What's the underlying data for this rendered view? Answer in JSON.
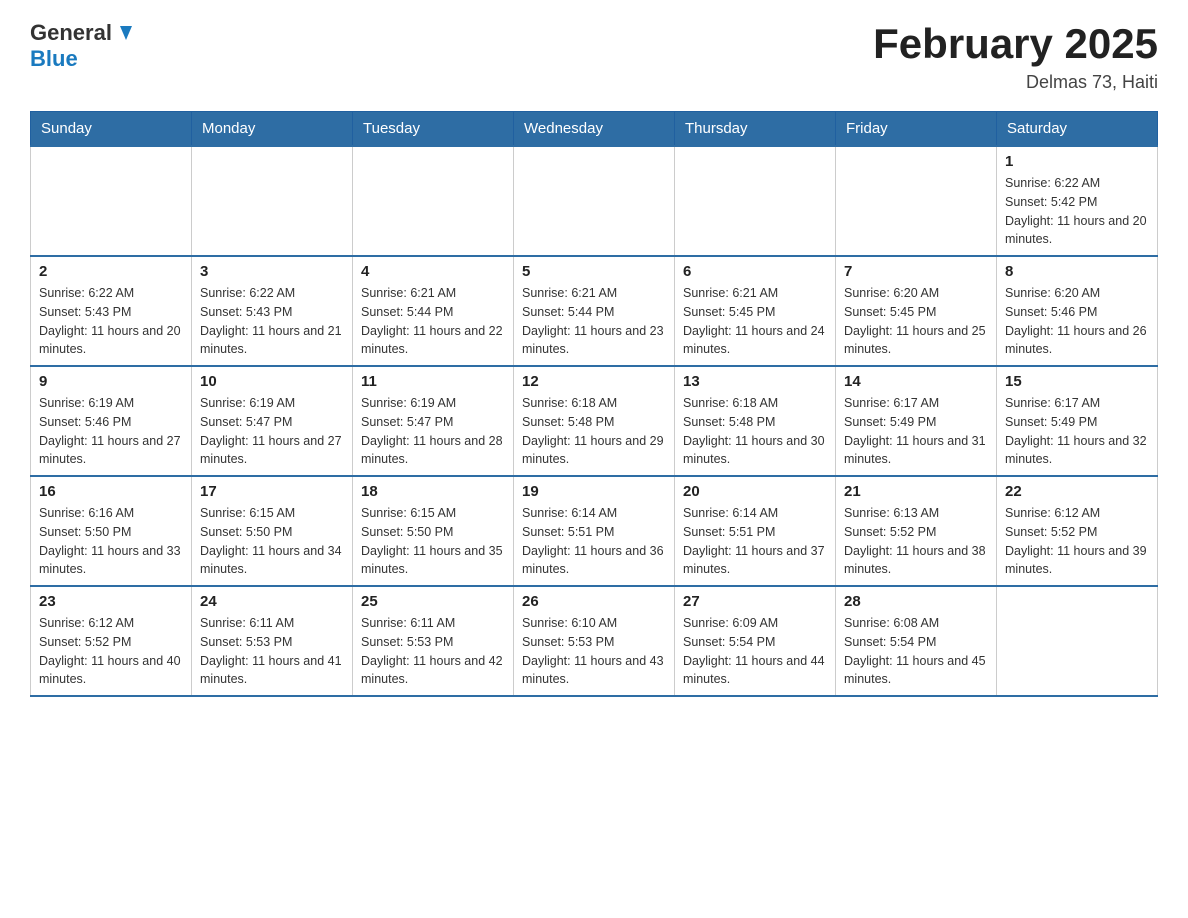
{
  "header": {
    "logo_general": "General",
    "logo_blue": "Blue",
    "month_title": "February 2025",
    "location": "Delmas 73, Haiti"
  },
  "days_of_week": [
    "Sunday",
    "Monday",
    "Tuesday",
    "Wednesday",
    "Thursday",
    "Friday",
    "Saturday"
  ],
  "weeks": [
    [
      {
        "day": "",
        "info": ""
      },
      {
        "day": "",
        "info": ""
      },
      {
        "day": "",
        "info": ""
      },
      {
        "day": "",
        "info": ""
      },
      {
        "day": "",
        "info": ""
      },
      {
        "day": "",
        "info": ""
      },
      {
        "day": "1",
        "info": "Sunrise: 6:22 AM\nSunset: 5:42 PM\nDaylight: 11 hours and 20 minutes."
      }
    ],
    [
      {
        "day": "2",
        "info": "Sunrise: 6:22 AM\nSunset: 5:43 PM\nDaylight: 11 hours and 20 minutes."
      },
      {
        "day": "3",
        "info": "Sunrise: 6:22 AM\nSunset: 5:43 PM\nDaylight: 11 hours and 21 minutes."
      },
      {
        "day": "4",
        "info": "Sunrise: 6:21 AM\nSunset: 5:44 PM\nDaylight: 11 hours and 22 minutes."
      },
      {
        "day": "5",
        "info": "Sunrise: 6:21 AM\nSunset: 5:44 PM\nDaylight: 11 hours and 23 minutes."
      },
      {
        "day": "6",
        "info": "Sunrise: 6:21 AM\nSunset: 5:45 PM\nDaylight: 11 hours and 24 minutes."
      },
      {
        "day": "7",
        "info": "Sunrise: 6:20 AM\nSunset: 5:45 PM\nDaylight: 11 hours and 25 minutes."
      },
      {
        "day": "8",
        "info": "Sunrise: 6:20 AM\nSunset: 5:46 PM\nDaylight: 11 hours and 26 minutes."
      }
    ],
    [
      {
        "day": "9",
        "info": "Sunrise: 6:19 AM\nSunset: 5:46 PM\nDaylight: 11 hours and 27 minutes."
      },
      {
        "day": "10",
        "info": "Sunrise: 6:19 AM\nSunset: 5:47 PM\nDaylight: 11 hours and 27 minutes."
      },
      {
        "day": "11",
        "info": "Sunrise: 6:19 AM\nSunset: 5:47 PM\nDaylight: 11 hours and 28 minutes."
      },
      {
        "day": "12",
        "info": "Sunrise: 6:18 AM\nSunset: 5:48 PM\nDaylight: 11 hours and 29 minutes."
      },
      {
        "day": "13",
        "info": "Sunrise: 6:18 AM\nSunset: 5:48 PM\nDaylight: 11 hours and 30 minutes."
      },
      {
        "day": "14",
        "info": "Sunrise: 6:17 AM\nSunset: 5:49 PM\nDaylight: 11 hours and 31 minutes."
      },
      {
        "day": "15",
        "info": "Sunrise: 6:17 AM\nSunset: 5:49 PM\nDaylight: 11 hours and 32 minutes."
      }
    ],
    [
      {
        "day": "16",
        "info": "Sunrise: 6:16 AM\nSunset: 5:50 PM\nDaylight: 11 hours and 33 minutes."
      },
      {
        "day": "17",
        "info": "Sunrise: 6:15 AM\nSunset: 5:50 PM\nDaylight: 11 hours and 34 minutes."
      },
      {
        "day": "18",
        "info": "Sunrise: 6:15 AM\nSunset: 5:50 PM\nDaylight: 11 hours and 35 minutes."
      },
      {
        "day": "19",
        "info": "Sunrise: 6:14 AM\nSunset: 5:51 PM\nDaylight: 11 hours and 36 minutes."
      },
      {
        "day": "20",
        "info": "Sunrise: 6:14 AM\nSunset: 5:51 PM\nDaylight: 11 hours and 37 minutes."
      },
      {
        "day": "21",
        "info": "Sunrise: 6:13 AM\nSunset: 5:52 PM\nDaylight: 11 hours and 38 minutes."
      },
      {
        "day": "22",
        "info": "Sunrise: 6:12 AM\nSunset: 5:52 PM\nDaylight: 11 hours and 39 minutes."
      }
    ],
    [
      {
        "day": "23",
        "info": "Sunrise: 6:12 AM\nSunset: 5:52 PM\nDaylight: 11 hours and 40 minutes."
      },
      {
        "day": "24",
        "info": "Sunrise: 6:11 AM\nSunset: 5:53 PM\nDaylight: 11 hours and 41 minutes."
      },
      {
        "day": "25",
        "info": "Sunrise: 6:11 AM\nSunset: 5:53 PM\nDaylight: 11 hours and 42 minutes."
      },
      {
        "day": "26",
        "info": "Sunrise: 6:10 AM\nSunset: 5:53 PM\nDaylight: 11 hours and 43 minutes."
      },
      {
        "day": "27",
        "info": "Sunrise: 6:09 AM\nSunset: 5:54 PM\nDaylight: 11 hours and 44 minutes."
      },
      {
        "day": "28",
        "info": "Sunrise: 6:08 AM\nSunset: 5:54 PM\nDaylight: 11 hours and 45 minutes."
      },
      {
        "day": "",
        "info": ""
      }
    ]
  ]
}
